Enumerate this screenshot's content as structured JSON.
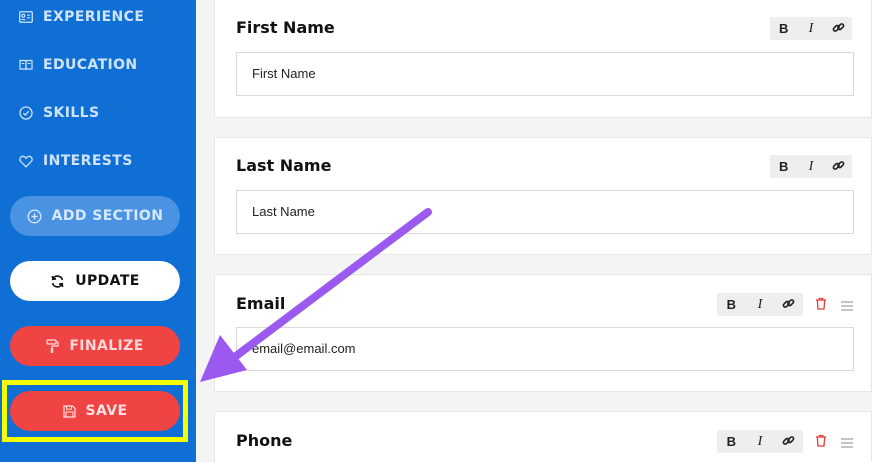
{
  "sidebar": {
    "nav": [
      {
        "label": "EXPERIENCE",
        "icon": "id-card-icon"
      },
      {
        "label": "EDUCATION",
        "icon": "book-icon"
      },
      {
        "label": "SKILLS",
        "icon": "check-circle-icon"
      },
      {
        "label": "INTERESTS",
        "icon": "heart-icon"
      }
    ],
    "add_section": "ADD SECTION",
    "update": "UPDATE",
    "finalize": "FINALIZE",
    "save": "SAVE"
  },
  "toolbar": {
    "bold": "B",
    "italic": "I"
  },
  "fields": {
    "first_name": {
      "title": "First Name",
      "value": "First Name"
    },
    "last_name": {
      "title": "Last Name",
      "value": "Last Name"
    },
    "email": {
      "title": "Email",
      "value": "email@email.com"
    },
    "phone": {
      "title": "Phone"
    }
  },
  "colors": {
    "sidebar": "#0f6fd4",
    "accent_red": "#f04444",
    "highlight": "#f5ff00",
    "arrow": "#9b59f0"
  }
}
